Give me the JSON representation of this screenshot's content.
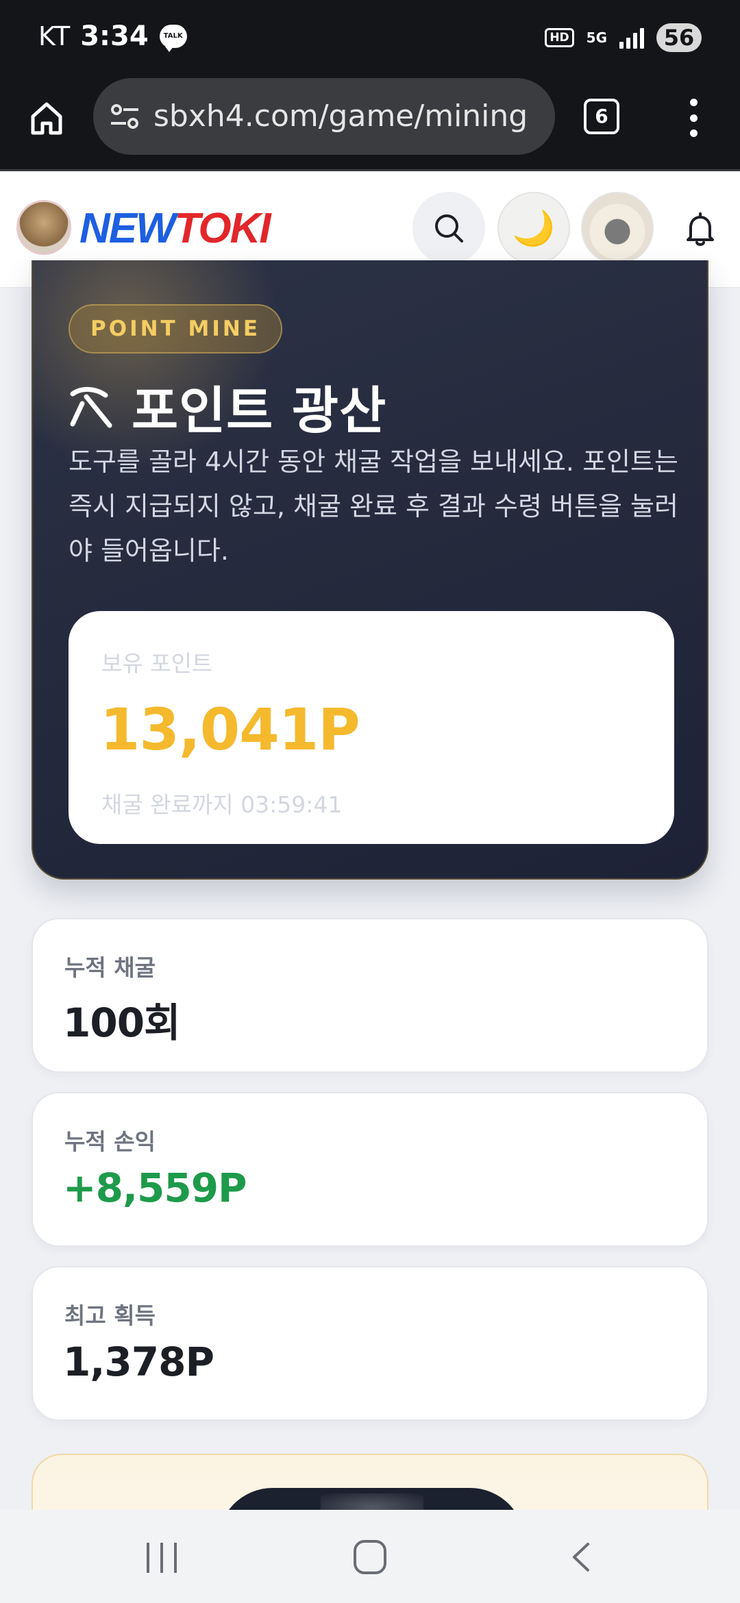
{
  "status_bar": {
    "carrier": "KT",
    "time": "3:34",
    "talk_icon_text": "TALK",
    "hd_label": "HD",
    "network": "5G",
    "battery": "56"
  },
  "browser": {
    "url": "sbxh4.com/game/mining",
    "tab_count": "6"
  },
  "site": {
    "logo_part1": "NEW",
    "logo_part2": "TOKI",
    "theme_icon": "🌙"
  },
  "hero": {
    "badge": "POINT MINE",
    "title": "포인트 광산",
    "description": "도구를 골라 4시간 동안 채굴 작업을 보내세요. 포인트는 즉시 지급되지 않고, 채굴 완료 후 결과 수령 버튼을 눌러야 들어옵니다.",
    "balance_label": "보유 포인트",
    "balance_value": "13,041P",
    "countdown": "채굴 완료까지 03:59:41"
  },
  "stats": [
    {
      "label": "누적 채굴",
      "value": "100회"
    },
    {
      "label": "누적 손익",
      "value": "+8,559P",
      "color": "#1e9a4b"
    },
    {
      "label": "최고 획득",
      "value": "1,378P"
    }
  ],
  "colors": {
    "accent_gold": "#f5b92e",
    "profit_green": "#1e9a4b",
    "hero_bg": "#262b3e"
  },
  "icons": [
    "home-icon",
    "site-settings-icon",
    "tabs-icon",
    "more-menu-icon",
    "search-icon",
    "moon-icon",
    "profile-avatar",
    "bell-icon",
    "pickaxe-icon",
    "nav-recent-icon",
    "nav-home-icon",
    "nav-back-icon"
  ]
}
